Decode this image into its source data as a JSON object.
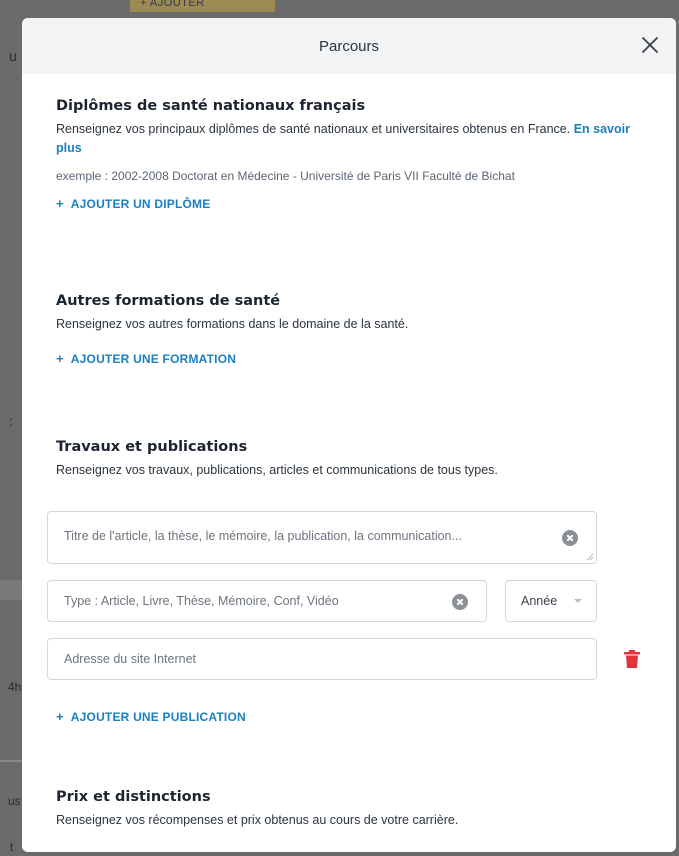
{
  "background": {
    "top_button_label": "+ AJOUTER",
    "frag_u": "u",
    "frag_colon": ":",
    "frag_4h": "4h",
    "frag_us": "us",
    "frag_t": "t"
  },
  "modal": {
    "title": "Parcours",
    "close_icon": "close-icon"
  },
  "diplomes": {
    "title": "Diplômes de santé nationaux français",
    "description": "Renseignez vos principaux diplômes de santé nationaux et universitaires obtenus en France.",
    "learn_more": "En savoir plus",
    "example": "exemple : 2002-2008 Doctorat en Médecine - Université de Paris VII Faculté de Bichat",
    "add_label": "AJOUTER UN DIPLÔME"
  },
  "formations": {
    "title": "Autres formations de santé",
    "description": "Renseignez vos autres formations dans le domaine de la santé.",
    "add_label": "AJOUTER UNE FORMATION"
  },
  "publications": {
    "title": "Travaux et publications",
    "description": "Renseignez vos travaux, publications, articles et communications de tous types.",
    "title_placeholder": "Titre de l'article, la thèse, le mémoire, la publication, la communication...",
    "type_placeholder": "Type : Article, Livre, Thèse, Mémoire, Conf, Vidéo",
    "year_placeholder": "Année",
    "url_placeholder": "Adresse du site Internet",
    "add_label": "AJOUTER UNE PUBLICATION"
  },
  "prix": {
    "title": "Prix et distinctions",
    "description": "Renseignez vos récompenses et prix obtenus au cours de votre carrière."
  },
  "add_plus": "+",
  "colors": {
    "accent": "#1a7fc1",
    "danger": "#e0333a",
    "header_bg": "#f2f4f6"
  }
}
